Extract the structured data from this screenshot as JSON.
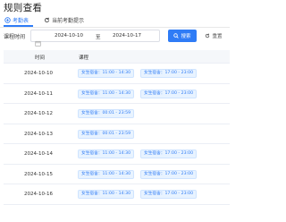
{
  "page": {
    "title": "规则查看"
  },
  "tabs": [
    {
      "label": "考勤表",
      "icon": "list-icon",
      "active": true
    },
    {
      "label": "当前考勤提示",
      "icon": "refresh-icon",
      "active": false
    }
  ],
  "filter": {
    "label": "课程时间",
    "start_date": "2024-10-10",
    "separator": "至",
    "end_date": "2024-10-17",
    "search_label": "搜索",
    "reset_label": "重置"
  },
  "table": {
    "columns": [
      "时间",
      "课程"
    ],
    "rows": [
      {
        "date": "2024-10-10",
        "tags": [
          "女生宿舍：11:00 - 14:30",
          "女生宿舍：17:00 - 23:00"
        ]
      },
      {
        "date": "2024-10-11",
        "tags": [
          "女生宿舍：11:00 - 14:30",
          "女生宿舍：17:00 - 23:00"
        ]
      },
      {
        "date": "2024-10-12",
        "tags": [
          "女生宿舍：00:01 - 23:59"
        ]
      },
      {
        "date": "2024-10-13",
        "tags": [
          "女生宿舍：00:01 - 23:59"
        ]
      },
      {
        "date": "2024-10-14",
        "tags": [
          "女生宿舍：11:00 - 14:30",
          "女生宿舍：17:00 - 23:00"
        ]
      },
      {
        "date": "2024-10-15",
        "tags": [
          "女生宿舍：11:00 - 14:30",
          "女生宿舍：17:00 - 23:00"
        ]
      },
      {
        "date": "2024-10-16",
        "tags": [
          "女生宿舍：11:00 - 14:30",
          "女生宿舍：17:00 - 23:00"
        ]
      }
    ]
  },
  "colors": {
    "accent": "#2f7cf6",
    "tag_bg": "#e8f3ff",
    "header_bg": "#f5f7fa"
  }
}
